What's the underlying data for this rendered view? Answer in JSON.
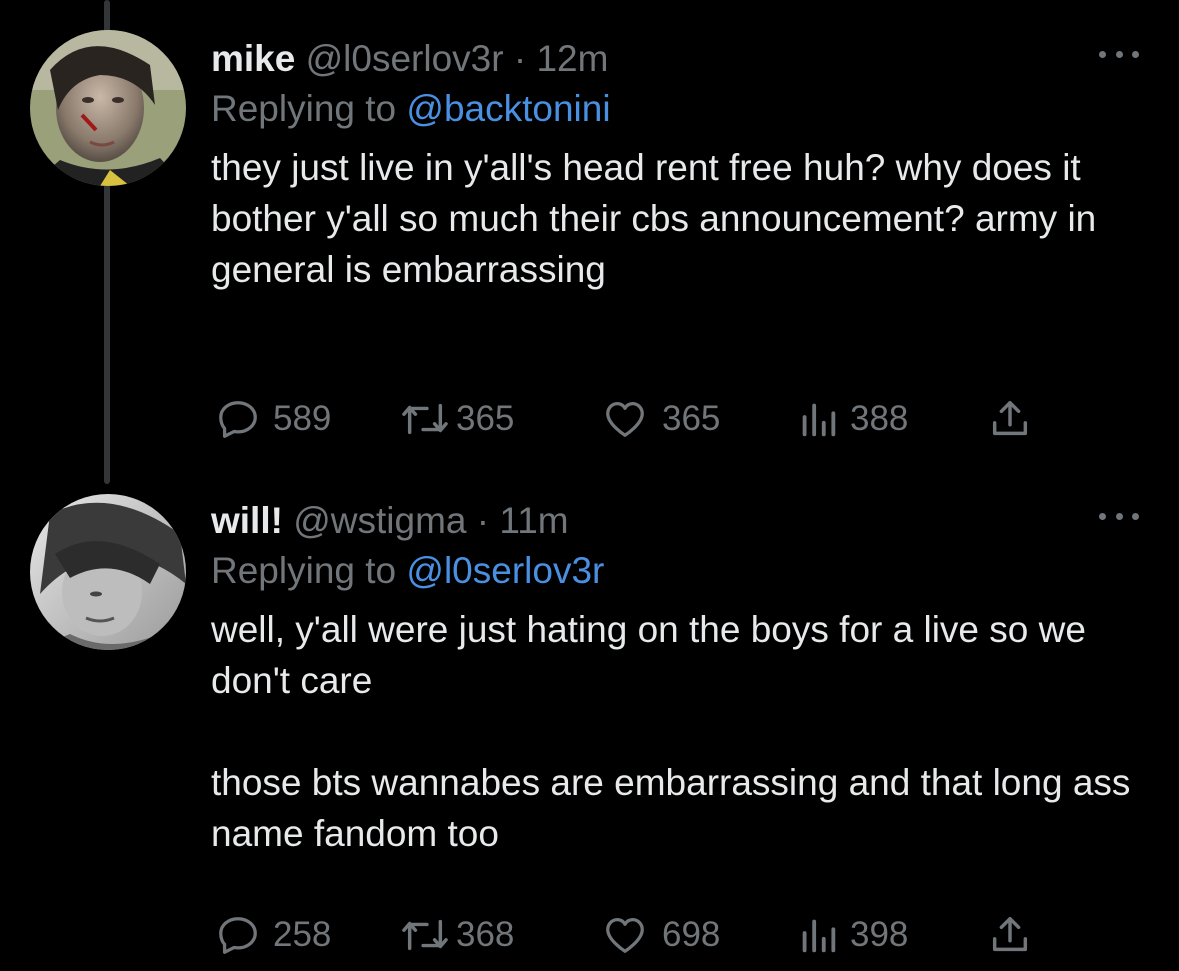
{
  "tweets": [
    {
      "display_name": "mike",
      "handle": "@l0serlov3r",
      "separator": "·",
      "time": "12m",
      "replying_prefix": "Replying to",
      "replying_to": "@backtonini",
      "text": "they just live in y'all's head rent free huh? why does it bother y'all so much their cbs announcement? army in general is embarrassing",
      "replies": "589",
      "retweets": "365",
      "likes": "365",
      "views": "388",
      "avatar_icon": "user-avatar-mike"
    },
    {
      "display_name": "will!",
      "handle": "@wstigma",
      "separator": "·",
      "time": "11m",
      "replying_prefix": "Replying to",
      "replying_to": "@l0serlov3r",
      "text": "well, y'all were just hating on the boys for a live so we don't care\n\nthose bts wannabes are embarrassing and that long ass name fandom too",
      "replies": "258",
      "retweets": "368",
      "likes": "698",
      "views": "398",
      "avatar_icon": "user-avatar-will"
    }
  ],
  "colors": {
    "background": "#000000",
    "text": "#e7e9ea",
    "secondary": "#71767b",
    "link": "#4a90e2",
    "thread_line": "#333639"
  },
  "icons": [
    "reply-icon",
    "retweet-icon",
    "like-icon",
    "views-icon",
    "share-icon",
    "more-icon"
  ]
}
